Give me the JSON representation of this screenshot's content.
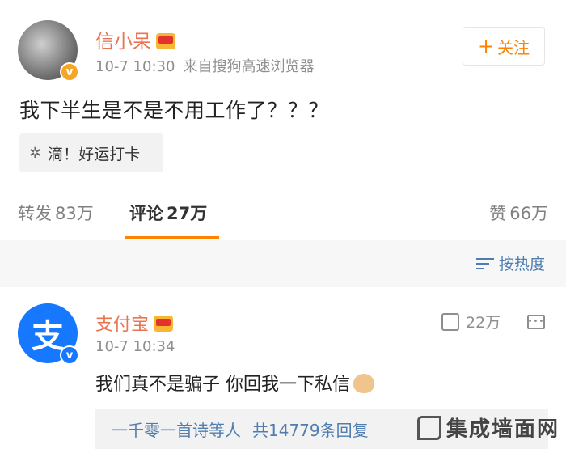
{
  "post": {
    "author": "信小呆",
    "time": "10-7 10:30",
    "source": "来自搜狗高速浏览器",
    "follow_label": "关注",
    "text": "我下半生是不是不用工作了？？？",
    "tag": "滴！好运打卡"
  },
  "tabs": {
    "repost_label": "转发",
    "repost_count": "83万",
    "comments_label": "评论",
    "comments_count": "27万",
    "likes_label": "赞",
    "likes_count": "66万"
  },
  "sort": {
    "label": "按热度"
  },
  "comment": {
    "author": "支付宝",
    "avatar_glyph": "支",
    "time": "10-7 10:34",
    "likes": "22万",
    "text": "我们真不是骗子 你回我一下私信",
    "replies_user": "一千零一首诗等人",
    "replies_count": "共14779条回复"
  },
  "watermark": {
    "text": "集成墙面网"
  },
  "colors": {
    "accent": "#ff8200",
    "username": "#eb7350",
    "link": "#507daf"
  }
}
